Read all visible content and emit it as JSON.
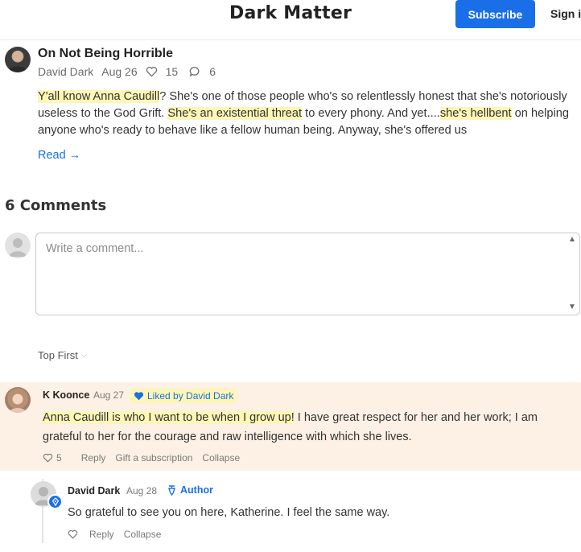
{
  "header": {
    "site_title": "Dark Matter",
    "subscribe_label": "Subscribe",
    "signin_label": "Sign in",
    "accent_color": "#1a6fe8"
  },
  "post": {
    "title": "On Not Being Horrible",
    "author": "David Dark",
    "date": "Aug 26",
    "likes": "15",
    "comments": "6",
    "excerpt_parts": {
      "hl1": "Y'all know Anna Caudill",
      "t1": "? She's one of those people who's so relentlessly honest that she's notoriously useless to the God Grift. ",
      "hl2": "She's an existential threat",
      "t2": " to every phony. And yet....",
      "hl3": "she's hellbent",
      "t3": " on helping anyone who's ready to behave like a fellow human being. Anyway, she's offered us"
    },
    "read_label": "Read →",
    "highlight_color": "#fdf6b5"
  },
  "comments_section": {
    "heading": "6 Comments",
    "input_placeholder": "Write a comment...",
    "sort_label": "Top First",
    "items": [
      {
        "author": "K Koonce",
        "date": "Aug 27",
        "liked_by": "Liked by David Dark",
        "body_highlight": "Anna Caudill is who I want to be when I grow up!",
        "body_rest": " I have great respect for her and her work; I am grateful to her for the courage and raw intelligence with which she lives.",
        "likes": "5",
        "reply_label": "Reply",
        "gift_label": "Gift a subscription",
        "collapse_label": "Collapse",
        "background_color": "#fcf1e4"
      },
      {
        "author": "David Dark",
        "date": "Aug 28",
        "badge": "Author",
        "body": "So grateful to see you on here, Katherine. I feel the same way.",
        "reply_label": "Reply",
        "collapse_label": "Collapse"
      }
    ]
  }
}
